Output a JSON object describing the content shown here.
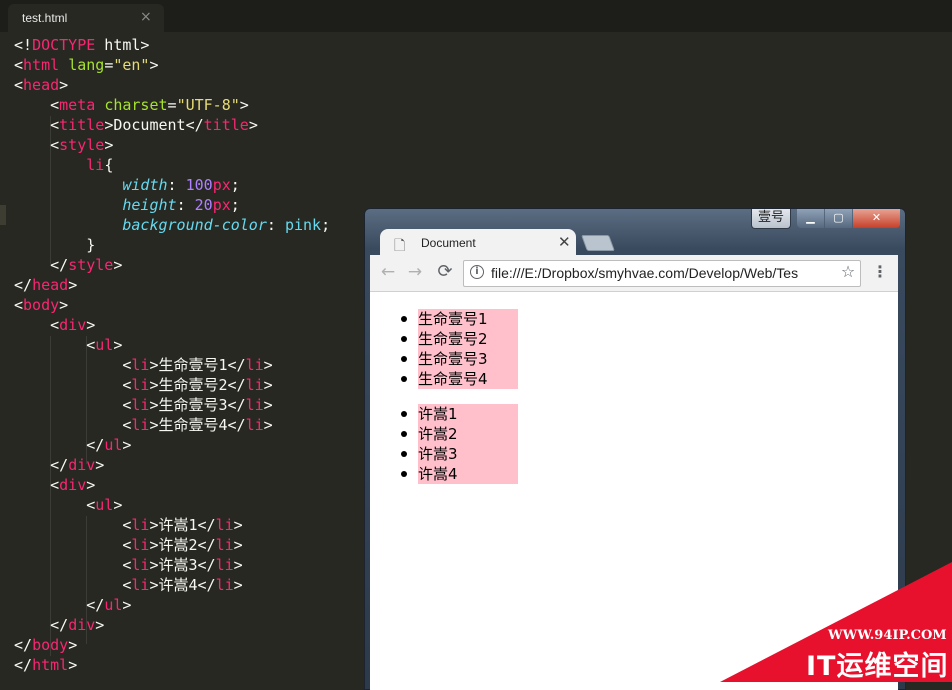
{
  "editor": {
    "tab": {
      "filename": "test.html",
      "close_glyph": "×"
    },
    "lines": [
      [
        {
          "c": "w",
          "t": "<!"
        },
        {
          "c": "t",
          "t": "DOCTYPE"
        },
        {
          "c": "w",
          "t": " html>"
        }
      ],
      [
        {
          "c": "w",
          "t": "<"
        },
        {
          "c": "t",
          "t": "html"
        },
        {
          "c": "w",
          "t": " "
        },
        {
          "c": "a",
          "t": "lang"
        },
        {
          "c": "w",
          "t": "="
        },
        {
          "c": "s",
          "t": "\"en\""
        },
        {
          "c": "w",
          "t": ">"
        }
      ],
      [
        {
          "c": "w",
          "t": "<"
        },
        {
          "c": "t",
          "t": "head"
        },
        {
          "c": "w",
          "t": ">"
        }
      ],
      [
        {
          "c": "w",
          "t": "    <"
        },
        {
          "c": "t",
          "t": "meta"
        },
        {
          "c": "w",
          "t": " "
        },
        {
          "c": "a",
          "t": "charset"
        },
        {
          "c": "w",
          "t": "="
        },
        {
          "c": "s",
          "t": "\"UTF-8\""
        },
        {
          "c": "w",
          "t": ">"
        }
      ],
      [
        {
          "c": "w",
          "t": "    <"
        },
        {
          "c": "t",
          "t": "title"
        },
        {
          "c": "w",
          "t": ">Document</"
        },
        {
          "c": "t",
          "t": "title"
        },
        {
          "c": "w",
          "t": ">"
        }
      ],
      [
        {
          "c": "w",
          "t": "    <"
        },
        {
          "c": "t",
          "t": "style"
        },
        {
          "c": "w",
          "t": ">"
        }
      ],
      [
        {
          "c": "w",
          "t": "        "
        },
        {
          "c": "t",
          "t": "li"
        },
        {
          "c": "w",
          "t": "{"
        }
      ],
      [
        {
          "c": "w",
          "t": "            "
        },
        {
          "c": "p",
          "t": "width"
        },
        {
          "c": "w",
          "t": ": "
        },
        {
          "c": "n",
          "t": "100"
        },
        {
          "c": "t",
          "t": "px"
        },
        {
          "c": "w",
          "t": ";"
        }
      ],
      [
        {
          "c": "w",
          "t": "            "
        },
        {
          "c": "p",
          "t": "height"
        },
        {
          "c": "w",
          "t": ": "
        },
        {
          "c": "n",
          "t": "20"
        },
        {
          "c": "t",
          "t": "px"
        },
        {
          "c": "w",
          "t": ";"
        }
      ],
      [
        {
          "c": "w",
          "t": "            "
        },
        {
          "c": "p",
          "t": "background-color"
        },
        {
          "c": "w",
          "t": ": "
        },
        {
          "c": "v",
          "t": "pink"
        },
        {
          "c": "w",
          "t": ";"
        }
      ],
      [
        {
          "c": "w",
          "t": "        }"
        }
      ],
      [
        {
          "c": "w",
          "t": "    </"
        },
        {
          "c": "t",
          "t": "style"
        },
        {
          "c": "w",
          "t": ">"
        }
      ],
      [
        {
          "c": "w",
          "t": "</"
        },
        {
          "c": "t",
          "t": "head"
        },
        {
          "c": "w",
          "t": ">"
        }
      ],
      [
        {
          "c": "w",
          "t": "<"
        },
        {
          "c": "t",
          "t": "body"
        },
        {
          "c": "w",
          "t": ">"
        }
      ],
      [
        {
          "c": "w",
          "t": "    <"
        },
        {
          "c": "t",
          "t": "div"
        },
        {
          "c": "w",
          "t": ">"
        }
      ],
      [
        {
          "c": "w",
          "t": "        <"
        },
        {
          "c": "t",
          "t": "ul"
        },
        {
          "c": "w",
          "t": ">"
        }
      ],
      [
        {
          "c": "w",
          "t": "            <"
        },
        {
          "c": "t",
          "t": "li"
        },
        {
          "c": "w",
          "t": ">生命壹号1</"
        },
        {
          "c": "t",
          "t": "li"
        },
        {
          "c": "w",
          "t": ">"
        }
      ],
      [
        {
          "c": "w",
          "t": "            <"
        },
        {
          "c": "t",
          "t": "li"
        },
        {
          "c": "w",
          "t": ">生命壹号2</"
        },
        {
          "c": "t",
          "t": "li"
        },
        {
          "c": "w",
          "t": ">"
        }
      ],
      [
        {
          "c": "w",
          "t": "            <"
        },
        {
          "c": "t",
          "t": "li"
        },
        {
          "c": "w",
          "t": ">生命壹号3</"
        },
        {
          "c": "t",
          "t": "li"
        },
        {
          "c": "w",
          "t": ">"
        }
      ],
      [
        {
          "c": "w",
          "t": "            <"
        },
        {
          "c": "t",
          "t": "li"
        },
        {
          "c": "w",
          "t": ">生命壹号4</"
        },
        {
          "c": "t",
          "t": "li"
        },
        {
          "c": "w",
          "t": ">"
        }
      ],
      [
        {
          "c": "w",
          "t": "        </"
        },
        {
          "c": "t",
          "t": "ul"
        },
        {
          "c": "w",
          "t": ">"
        }
      ],
      [
        {
          "c": "w",
          "t": "    </"
        },
        {
          "c": "t",
          "t": "div"
        },
        {
          "c": "w",
          "t": ">"
        }
      ],
      [
        {
          "c": "w",
          "t": "    <"
        },
        {
          "c": "t",
          "t": "div"
        },
        {
          "c": "w",
          "t": ">"
        }
      ],
      [
        {
          "c": "w",
          "t": "        <"
        },
        {
          "c": "t",
          "t": "ul"
        },
        {
          "c": "w",
          "t": ">"
        }
      ],
      [
        {
          "c": "w",
          "t": "            <"
        },
        {
          "c": "t",
          "t": "li"
        },
        {
          "c": "w",
          "t": ">许嵩1</"
        },
        {
          "c": "t",
          "t": "li"
        },
        {
          "c": "w",
          "t": ">"
        }
      ],
      [
        {
          "c": "w",
          "t": "            <"
        },
        {
          "c": "t",
          "t": "li"
        },
        {
          "c": "w",
          "t": ">许嵩2</"
        },
        {
          "c": "t",
          "t": "li"
        },
        {
          "c": "w",
          "t": ">"
        }
      ],
      [
        {
          "c": "w",
          "t": "            <"
        },
        {
          "c": "t",
          "t": "li"
        },
        {
          "c": "w",
          "t": ">许嵩3</"
        },
        {
          "c": "t",
          "t": "li"
        },
        {
          "c": "w",
          "t": ">"
        }
      ],
      [
        {
          "c": "w",
          "t": "            <"
        },
        {
          "c": "t",
          "t": "li"
        },
        {
          "c": "w",
          "t": ">许嵩4</"
        },
        {
          "c": "t",
          "t": "li"
        },
        {
          "c": "w",
          "t": ">"
        }
      ],
      [
        {
          "c": "w",
          "t": "        </"
        },
        {
          "c": "t",
          "t": "ul"
        },
        {
          "c": "w",
          "t": ">"
        }
      ],
      [
        {
          "c": "w",
          "t": "    </"
        },
        {
          "c": "t",
          "t": "div"
        },
        {
          "c": "w",
          "t": ">"
        }
      ],
      [
        {
          "c": "w",
          "t": "</"
        },
        {
          "c": "t",
          "t": "body"
        },
        {
          "c": "w",
          "t": ">"
        }
      ],
      [
        {
          "c": "w",
          "t": "</"
        },
        {
          "c": "t",
          "t": "html"
        },
        {
          "c": "w",
          "t": ">"
        }
      ]
    ],
    "colors": {
      "background": "#272822",
      "tag": "#f92672",
      "attr": "#a6e22e",
      "string": "#e6db74",
      "number": "#ae81ff",
      "property": "#66d9ef"
    }
  },
  "browser": {
    "ime_label": "壹号",
    "window_buttons": {
      "minimize": "▁",
      "maximize": "▢",
      "close": "✕"
    },
    "tab": {
      "title": "Document",
      "icon": "document-icon",
      "close_glyph": "✕"
    },
    "nav": {
      "back": "←",
      "forward": "→",
      "reload": "⟳"
    },
    "url": "file:///E:/Dropbox/smyhvae.com/Develop/Web/Tes",
    "info_glyph": "i",
    "star_glyph": "☆",
    "menu_glyph": "⋮",
    "list1": [
      "生命壹号1",
      "生命壹号2",
      "生命壹号3",
      "生命壹号4"
    ],
    "list2": [
      "许嵩1",
      "许嵩2",
      "许嵩3",
      "许嵩4"
    ],
    "li_background": "pink"
  },
  "watermark": {
    "url": "WWW.94IP.COM",
    "name": "IT运维空间",
    "color": "#e8112d"
  }
}
